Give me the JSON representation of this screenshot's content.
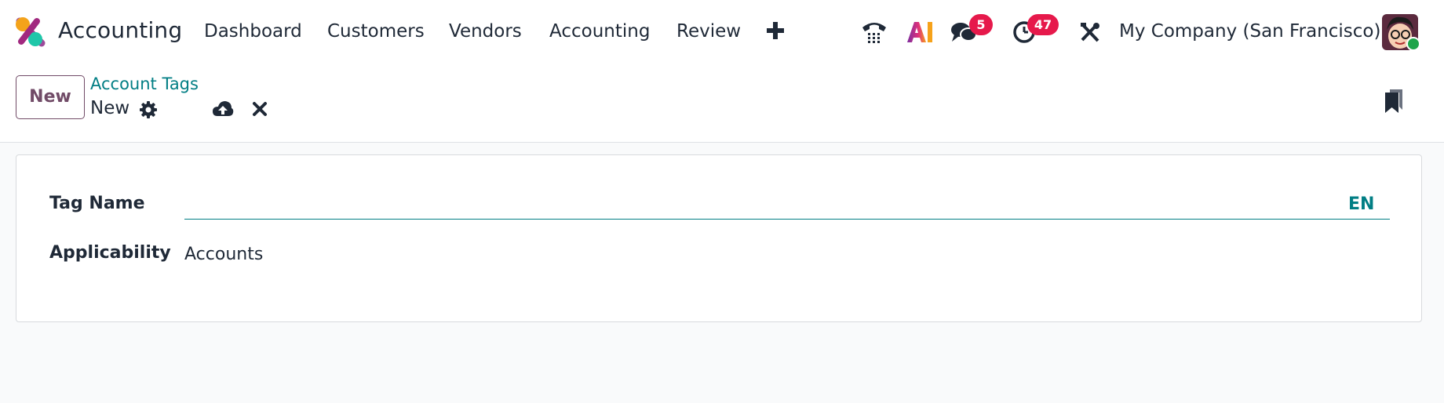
{
  "app": {
    "title": "Accounting"
  },
  "menu": {
    "items": [
      {
        "label": "Dashboard"
      },
      {
        "label": "Customers"
      },
      {
        "label": "Vendors"
      },
      {
        "label": "Accounting"
      },
      {
        "label": "Review"
      }
    ],
    "add_icon": "plus-icon"
  },
  "systray": {
    "phone_icon": "phone-icon",
    "ai_label": "AI",
    "messages_count": "5",
    "activities_count": "47",
    "tools_icon": "tools-icon",
    "company": "My Company (San Francisco)",
    "presence_color": "#1ea44a"
  },
  "control": {
    "new_label": "New",
    "breadcrumb_parent": "Account Tags",
    "breadcrumb_current": "New"
  },
  "form": {
    "tag_name_label": "Tag Name",
    "tag_name_value": "",
    "language": "EN",
    "applicability_label": "Applicability",
    "applicability_value": "Accounts"
  },
  "colors": {
    "brand": "#714b67",
    "accent": "#017e84",
    "badge": "#e6194b"
  }
}
